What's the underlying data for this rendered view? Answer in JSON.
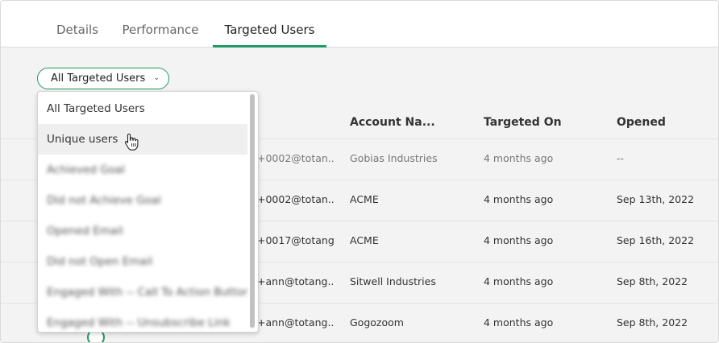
{
  "tabs": [
    {
      "label": "Details"
    },
    {
      "label": "Performance"
    },
    {
      "label": "Targeted Users"
    }
  ],
  "active_tab": "Targeted Users",
  "accent_color": "#1f9a63",
  "filter": {
    "selected": "All Targeted Users",
    "chevron_icon": "chevron-down-icon"
  },
  "table": {
    "headers": {
      "account": "Account Na...",
      "targeted_on": "Targeted On",
      "opened": "Opened"
    },
    "rows": [
      {
        "email": "+0002@totan...",
        "account": "Gobias Industries",
        "targeted_on": "4 months ago",
        "opened": "--"
      },
      {
        "email": "+0002@totan...",
        "account": "ACME",
        "targeted_on": "4 months ago",
        "opened": "Sep 13th, 2022"
      },
      {
        "email": "+0017@totang...",
        "account": "ACME",
        "targeted_on": "4 months ago",
        "opened": "Sep 16th, 2022"
      },
      {
        "email": "+ann@totang...",
        "account": "Sitwell Industries",
        "targeted_on": "4 months ago",
        "opened": "Sep 8th, 2022"
      },
      {
        "email": "+ann@totang...",
        "account": "Gogozoom",
        "targeted_on": "4 months ago",
        "opened": "Sep 8th, 2022"
      }
    ]
  },
  "dropdown": {
    "options": [
      {
        "label": "All Targeted Users"
      },
      {
        "label": "Unique users"
      },
      {
        "label": "Achieved Goal"
      },
      {
        "label": "Did not Achieve Goal"
      },
      {
        "label": "Opened Email"
      },
      {
        "label": "Did not Open Email"
      },
      {
        "label": "Engaged With -- Call To Action Button"
      },
      {
        "label": "Engaged With -- Unsubscribe Link"
      }
    ],
    "hovered": "Unique users"
  }
}
